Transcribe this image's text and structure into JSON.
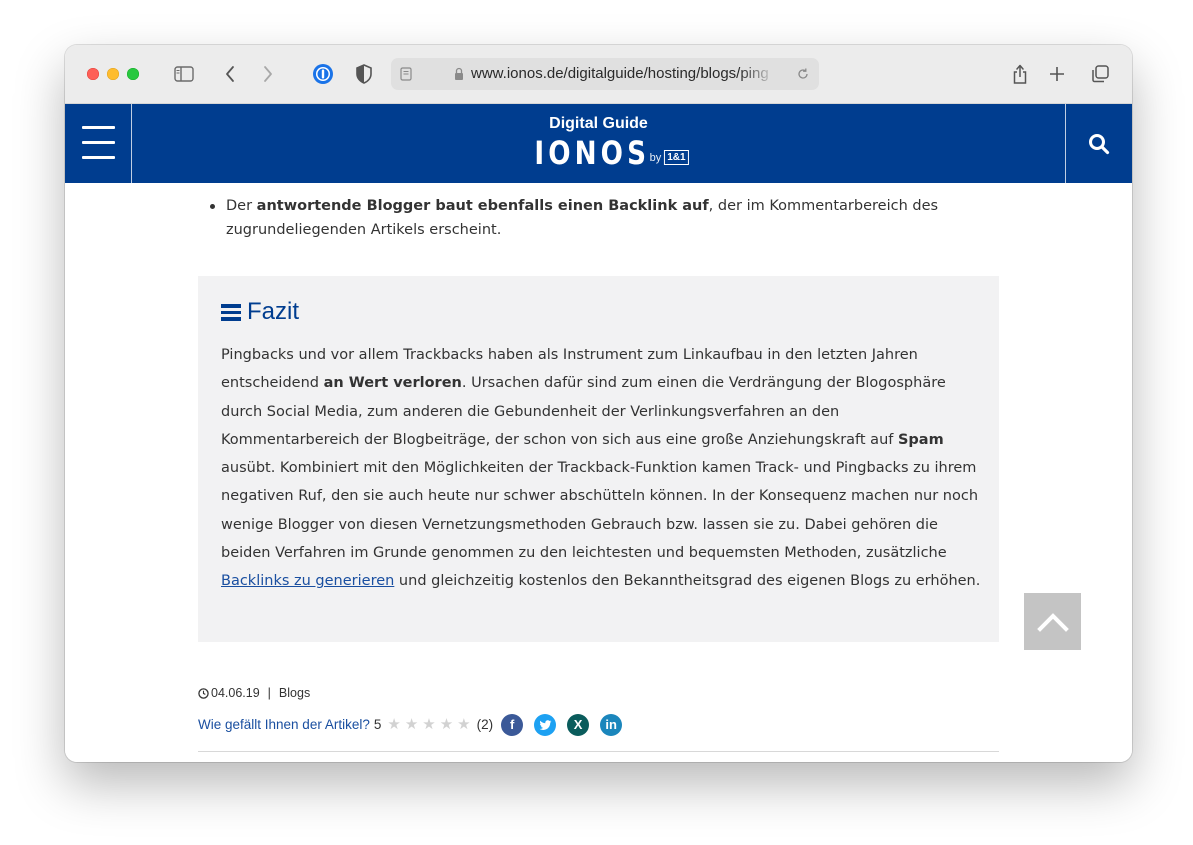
{
  "browser": {
    "url": "www.ionos.de/digitalguide/hosting/blogs/ping",
    "icons": [
      "sidebar-icon",
      "back-icon",
      "forward-icon",
      "password-manager-icon",
      "privacy-shield-icon",
      "page-icon",
      "lock-icon",
      "reload-icon",
      "share-icon",
      "new-tab-icon",
      "tab-overview-icon"
    ]
  },
  "header": {
    "subtitle": "Digital Guide",
    "logo": "IONOS",
    "by": "by",
    "badge": "1&1",
    "bg_color": "#003d8f"
  },
  "article": {
    "bullet_bold": "antwortende Blogger baut ebenfalls einen Backlink auf",
    "bullet_prefix": "Der ",
    "bullet_suffix": ", der im Kommentarbereich des zugrundeliegenden Artikels erscheint."
  },
  "fazit": {
    "title": "Fazit",
    "p1": "Pingbacks und vor allem Trackbacks haben als Instrument zum Linkaufbau in den letzten Jahren entscheidend ",
    "p1_bold": "an Wert verloren",
    "p2": ". Ursachen dafür sind zum einen die Verdrängung der Blogosphäre durch Social Media, zum anderen die Gebundenheit der Verlinkungsverfahren an den Kommentarbereich der Blogbeiträge, der schon von sich aus eine große Anziehungskraft auf ",
    "p2_bold": "Spam",
    "p3": " ausübt. Kombiniert mit den Möglichkeiten der Trackback-Funktion kamen Track- und Pingbacks zu ihrem negativen Ruf, den sie auch heute nur schwer abschütteln können. In der Konsequenz machen nur noch wenige Blogger von diesen Vernetzungsmethoden Gebrauch bzw. lassen sie zu. Dabei gehören die beiden Verfahren im Grunde genommen zu den leichtesten und bequemsten Methoden, zusätzliche ",
    "link": "Backlinks zu generieren",
    "p4": " und gleichzeitig kostenlos den Bekanntheitsgrad des eigenen Blogs zu erhöhen."
  },
  "meta": {
    "date": "04.06.19",
    "separator": "|",
    "category": "Blogs"
  },
  "rating": {
    "question": "Wie gefällt Ihnen der Artikel?",
    "score": "5",
    "count": "(2)",
    "stars_filled": 0,
    "stars_total": 5
  },
  "share": {
    "facebook": "f",
    "twitter": "t",
    "xing": "X",
    "linkedin": "in",
    "colors": {
      "facebook": "#3b5998",
      "twitter": "#1da1f2",
      "xing": "#0a5c5c",
      "linkedin": "#1b86bc"
    }
  }
}
